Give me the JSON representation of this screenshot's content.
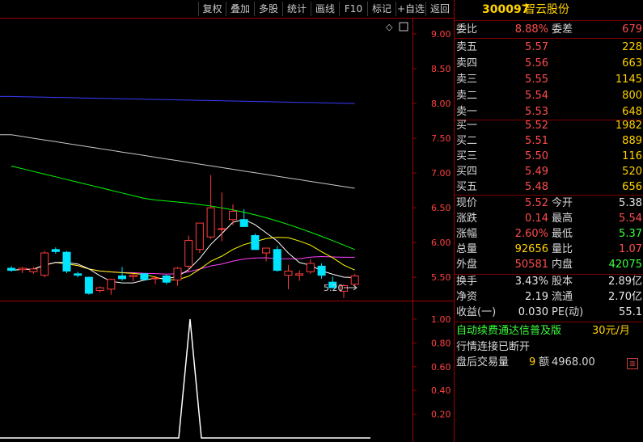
{
  "toolbar": {
    "buttons": [
      "复权",
      "叠加",
      "多股",
      "统计",
      "画线",
      "F10",
      "标记",
      "+自选",
      "返回"
    ]
  },
  "chart": {
    "price_ticks": [
      "9.00",
      "8.50",
      "8.00",
      "7.50",
      "7.00",
      "6.50",
      "6.00",
      "5.50"
    ],
    "volume_ticks": [
      "1.00",
      "0.80",
      "0.60",
      "0.40",
      "0.20"
    ],
    "low_annotation": "5.20",
    "settings_glyph": "◇",
    "colors": {
      "up": "#ff3c3c",
      "down": "#00e5ff",
      "ma5": "#ffffff",
      "ma10": "#ffff00",
      "ma20": "#ff40ff",
      "ma60": "#00ff00",
      "ma120": "#c8c8c8",
      "ma250": "#3a3aff",
      "axis": "#a00000"
    }
  },
  "chart_data": {
    "type": "candlestick",
    "candles": [
      {
        "o": 5.63,
        "h": 5.66,
        "l": 5.58,
        "c": 5.6
      },
      {
        "o": 5.61,
        "h": 5.65,
        "l": 5.56,
        "c": 5.63
      },
      {
        "o": 5.58,
        "h": 5.65,
        "l": 5.55,
        "c": 5.62
      },
      {
        "o": 5.53,
        "h": 5.88,
        "l": 5.5,
        "c": 5.85
      },
      {
        "o": 5.9,
        "h": 5.93,
        "l": 5.84,
        "c": 5.87
      },
      {
        "o": 5.86,
        "h": 5.88,
        "l": 5.56,
        "c": 5.59
      },
      {
        "o": 5.55,
        "h": 5.58,
        "l": 5.5,
        "c": 5.53
      },
      {
        "o": 5.5,
        "h": 5.51,
        "l": 5.25,
        "c": 5.27
      },
      {
        "o": 5.31,
        "h": 5.37,
        "l": 5.28,
        "c": 5.35
      },
      {
        "o": 5.33,
        "h": 5.48,
        "l": 5.25,
        "c": 5.47
      },
      {
        "o": 5.52,
        "h": 5.65,
        "l": 5.45,
        "c": 5.48
      },
      {
        "o": 5.51,
        "h": 5.55,
        "l": 5.44,
        "c": 5.53
      },
      {
        "o": 5.55,
        "h": 5.56,
        "l": 5.45,
        "c": 5.47
      },
      {
        "o": 5.49,
        "h": 5.52,
        "l": 5.4,
        "c": 5.49
      },
      {
        "o": 5.52,
        "h": 5.54,
        "l": 5.4,
        "c": 5.43
      },
      {
        "o": 5.46,
        "h": 5.65,
        "l": 5.38,
        "c": 5.63
      },
      {
        "o": 5.66,
        "h": 6.1,
        "l": 5.58,
        "c": 6.03
      },
      {
        "o": 5.9,
        "h": 6.28,
        "l": 5.85,
        "c": 6.28
      },
      {
        "o": 6.08,
        "h": 6.97,
        "l": 6.05,
        "c": 6.5
      },
      {
        "o": 6.19,
        "h": 6.72,
        "l": 6.02,
        "c": 6.2
      },
      {
        "o": 6.33,
        "h": 6.55,
        "l": 6.25,
        "c": 6.45
      },
      {
        "o": 6.33,
        "h": 6.48,
        "l": 6.28,
        "c": 6.23
      },
      {
        "o": 6.1,
        "h": 6.13,
        "l": 5.95,
        "c": 5.9
      },
      {
        "o": 5.85,
        "h": 5.92,
        "l": 5.73,
        "c": 5.92
      },
      {
        "o": 5.9,
        "h": 5.95,
        "l": 5.58,
        "c": 5.6
      },
      {
        "o": 5.53,
        "h": 5.68,
        "l": 5.33,
        "c": 5.59
      },
      {
        "o": 5.53,
        "h": 5.6,
        "l": 5.45,
        "c": 5.55
      },
      {
        "o": 5.58,
        "h": 5.76,
        "l": 5.55,
        "c": 5.7
      },
      {
        "o": 5.66,
        "h": 5.7,
        "l": 5.48,
        "c": 5.53
      },
      {
        "o": 5.43,
        "h": 5.51,
        "l": 5.36,
        "c": 5.35
      },
      {
        "o": 5.3,
        "h": 5.4,
        "l": 5.2,
        "c": 5.38
      },
      {
        "o": 5.4,
        "h": 5.55,
        "l": 5.36,
        "c": 5.52
      }
    ],
    "ylim": [
      5.2,
      9.0
    ],
    "volume_ylim": [
      0,
      1.0
    ]
  },
  "quote": {
    "code": "300097",
    "name": "智云股份",
    "weibi_label": "委比",
    "weibi": "8.88%",
    "weicha_label": "委差",
    "weicha": "679",
    "asks": [
      {
        "label": "卖五",
        "price": "5.57",
        "vol": "228"
      },
      {
        "label": "卖四",
        "price": "5.56",
        "vol": "663"
      },
      {
        "label": "卖三",
        "price": "5.55",
        "vol": "1145"
      },
      {
        "label": "卖二",
        "price": "5.54",
        "vol": "800"
      },
      {
        "label": "卖一",
        "price": "5.53",
        "vol": "648"
      }
    ],
    "bids": [
      {
        "label": "买一",
        "price": "5.52",
        "vol": "1982"
      },
      {
        "label": "买二",
        "price": "5.51",
        "vol": "889"
      },
      {
        "label": "买三",
        "price": "5.50",
        "vol": "116"
      },
      {
        "label": "买四",
        "price": "5.49",
        "vol": "520"
      },
      {
        "label": "买五",
        "price": "5.48",
        "vol": "656"
      }
    ],
    "stats": [
      {
        "l1": "现价",
        "v1": "5.52",
        "c1": "red",
        "l2": "今开",
        "v2": "5.38",
        "c2": "white"
      },
      {
        "l1": "涨跌",
        "v1": "0.14",
        "c1": "red",
        "l2": "最高",
        "v2": "5.54",
        "c2": "red"
      },
      {
        "l1": "涨幅",
        "v1": "2.60%",
        "c1": "red",
        "l2": "最低",
        "v2": "5.37",
        "c2": "green"
      },
      {
        "l1": "总量",
        "v1": "92656",
        "c1": "yellow",
        "l2": "量比",
        "v2": "1.07",
        "c2": "red"
      },
      {
        "l1": "外盘",
        "v1": "50581",
        "c1": "red",
        "l2": "内盘",
        "v2": "42075",
        "c2": "green"
      }
    ],
    "stats2": [
      {
        "l1": "换手",
        "v1": "3.43%",
        "l2": "股本",
        "v2": "2.89亿"
      },
      {
        "l1": "净资",
        "v1": "2.19",
        "l2": "流通",
        "v2": "2.70亿"
      },
      {
        "l1": "收益(一)",
        "v1": "0.030",
        "l2": "PE(动)",
        "v2": "55.1"
      }
    ],
    "promo": "自动续费通达信普及版",
    "promo_price": "30元/月",
    "disconnect": "行情连接已断开",
    "after_hours_label": "盘后交易量",
    "after_hours_vol": "9",
    "after_hours_amt_label": "额",
    "after_hours_amt": "4968.00"
  }
}
